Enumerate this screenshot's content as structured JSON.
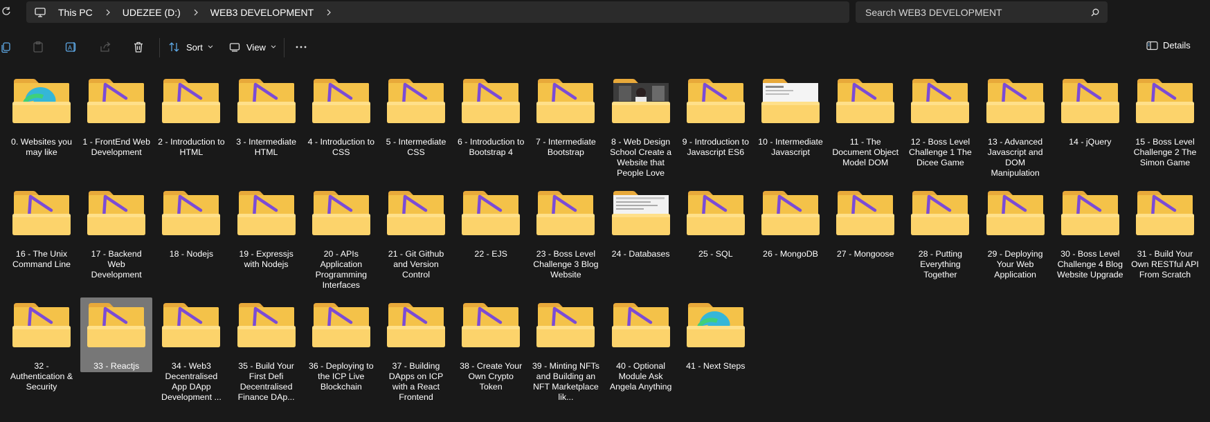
{
  "address": {
    "breadcrumbs": [
      "This PC",
      "UDEZEE (D:)",
      "WEB3 DEVELOPMENT"
    ],
    "pc_icon": "monitor-icon",
    "refresh_icon": "refresh-icon"
  },
  "search": {
    "placeholder": "Search WEB3 DEVELOPMENT"
  },
  "toolbar": {
    "sort_label": "Sort",
    "view_label": "View",
    "details_label": "Details",
    "icons": [
      "copy-icon",
      "paste-icon",
      "rename-icon",
      "share-icon",
      "delete-icon",
      "more-icon"
    ]
  },
  "folders": [
    {
      "label": "0. Websites you may like",
      "thumb": "edge"
    },
    {
      "label": "1 - FrontEnd Web Development",
      "thumb": "play"
    },
    {
      "label": "2 - Introduction to HTML",
      "thumb": "play"
    },
    {
      "label": "3 - Intermediate HTML",
      "thumb": "play"
    },
    {
      "label": "4 - Introduction to CSS",
      "thumb": "play"
    },
    {
      "label": "5 - Intermediate CSS",
      "thumb": "play"
    },
    {
      "label": "6 - Introduction to Bootstrap 4",
      "thumb": "play"
    },
    {
      "label": "7 - Intermediate Bootstrap",
      "thumb": "play"
    },
    {
      "label": "8 - Web Design School Create a Website that People Love",
      "thumb": "photo"
    },
    {
      "label": "9 - Introduction to Javascript ES6",
      "thumb": "play"
    },
    {
      "label": "10 - Intermediate Javascript",
      "thumb": "doc"
    },
    {
      "label": "11 - The Document Object Model DOM",
      "thumb": "play"
    },
    {
      "label": "12 - Boss Level Challenge 1 The Dicee Game",
      "thumb": "play"
    },
    {
      "label": "13 - Advanced Javascript and DOM Manipulation",
      "thumb": "play"
    },
    {
      "label": "14 - jQuery",
      "thumb": "play"
    },
    {
      "label": "15 - Boss Level Challenge 2 The Simon Game",
      "thumb": "play"
    },
    {
      "label": "16 - The Unix Command Line",
      "thumb": "play"
    },
    {
      "label": "17 - Backend Web Development",
      "thumb": "play"
    },
    {
      "label": "18 - Nodejs",
      "thumb": "play"
    },
    {
      "label": "19 - Expressjs with Nodejs",
      "thumb": "play"
    },
    {
      "label": "20 - APIs Application Programming Interfaces",
      "thumb": "play"
    },
    {
      "label": "21 - Git Github and Version Control",
      "thumb": "play"
    },
    {
      "label": "22 - EJS",
      "thumb": "play"
    },
    {
      "label": "23 - Boss Level Challenge 3 Blog Website",
      "thumb": "play"
    },
    {
      "label": "24 - Databases",
      "thumb": "doc2"
    },
    {
      "label": "25 - SQL",
      "thumb": "play"
    },
    {
      "label": "26 - MongoDB",
      "thumb": "play"
    },
    {
      "label": "27 - Mongoose",
      "thumb": "play"
    },
    {
      "label": "28 - Putting Everything Together",
      "thumb": "play"
    },
    {
      "label": "29 - Deploying Your Web Application",
      "thumb": "play"
    },
    {
      "label": "30 - Boss Level Challenge 4 Blog Website Upgrade",
      "thumb": "play"
    },
    {
      "label": "31 - Build Your Own RESTful API From Scratch",
      "thumb": "play"
    },
    {
      "label": "32 - Authentication & Security",
      "thumb": "play"
    },
    {
      "label": "33 - Reactjs",
      "thumb": "play",
      "selected": true
    },
    {
      "label": "34 - Web3 Decentralised App DApp Development ...",
      "thumb": "play"
    },
    {
      "label": "35 - Build Your First Defi Decentralised Finance DAp...",
      "thumb": "play"
    },
    {
      "label": "36 - Deploying to the ICP Live Blockchain",
      "thumb": "play"
    },
    {
      "label": "37 - Building DApps on ICP with a React Frontend",
      "thumb": "play"
    },
    {
      "label": "38 - Create Your Own Crypto Token",
      "thumb": "play"
    },
    {
      "label": "39 - Minting NFTs and Building an NFT Marketplace lik...",
      "thumb": "play"
    },
    {
      "label": "40 - Optional Module Ask Angela Anything",
      "thumb": "play"
    },
    {
      "label": "41 - Next Steps",
      "thumb": "edge"
    }
  ]
}
